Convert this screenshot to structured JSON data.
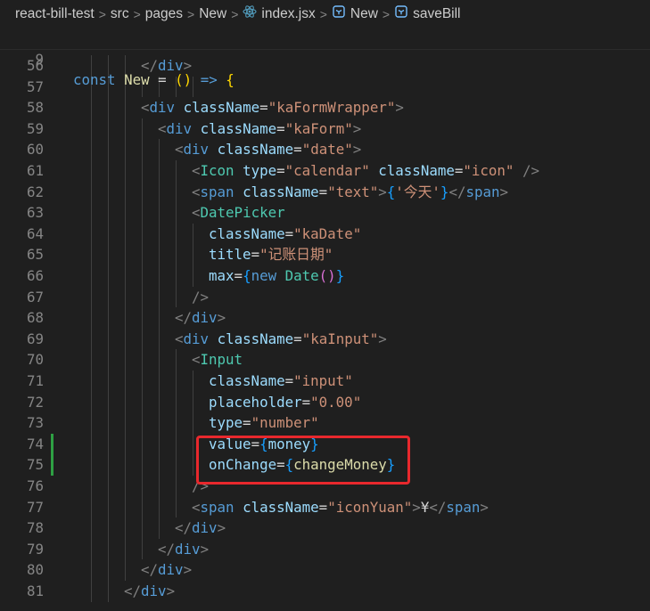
{
  "breadcrumb": {
    "items": [
      "react-bill-test",
      "src",
      "pages",
      "New",
      "index.jsx",
      "New",
      "saveBill"
    ],
    "separator": ">",
    "icons": [
      "",
      "",
      "",
      "",
      "react-icon",
      "symbol-cube-icon",
      "symbol-cube-icon"
    ]
  },
  "sticky_line": {
    "number": "9",
    "tokens": [
      {
        "t": "const ",
        "c": "kw"
      },
      {
        "t": "New",
        "c": "fn"
      },
      {
        "t": " = ",
        "c": "plain"
      },
      {
        "t": "()",
        "c": "yellowbrace"
      },
      {
        "t": " => ",
        "c": "kw"
      },
      {
        "t": "{",
        "c": "yellowbrace"
      }
    ]
  },
  "lines": [
    {
      "number": "56",
      "indent": 8,
      "tokens": [
        {
          "t": "</",
          "c": "punct"
        },
        {
          "t": "div",
          "c": "tag"
        },
        {
          "t": ">",
          "c": "punct"
        }
      ]
    },
    {
      "number": "57",
      "indent": 0,
      "tokens": []
    },
    {
      "number": "58",
      "indent": 8,
      "tokens": [
        {
          "t": "<",
          "c": "punct"
        },
        {
          "t": "div",
          "c": "tag"
        },
        {
          "t": " className",
          "c": "attr"
        },
        {
          "t": "=",
          "c": "plain"
        },
        {
          "t": "\"kaFormWrapper\"",
          "c": "str"
        },
        {
          "t": ">",
          "c": "punct"
        }
      ]
    },
    {
      "number": "59",
      "indent": 10,
      "tokens": [
        {
          "t": "<",
          "c": "punct"
        },
        {
          "t": "div",
          "c": "tag"
        },
        {
          "t": " className",
          "c": "attr"
        },
        {
          "t": "=",
          "c": "plain"
        },
        {
          "t": "\"kaForm\"",
          "c": "str"
        },
        {
          "t": ">",
          "c": "punct"
        }
      ]
    },
    {
      "number": "60",
      "indent": 12,
      "tokens": [
        {
          "t": "<",
          "c": "punct"
        },
        {
          "t": "div",
          "c": "tag"
        },
        {
          "t": " className",
          "c": "attr"
        },
        {
          "t": "=",
          "c": "plain"
        },
        {
          "t": "\"date\"",
          "c": "str"
        },
        {
          "t": ">",
          "c": "punct"
        }
      ]
    },
    {
      "number": "61",
      "indent": 14,
      "tokens": [
        {
          "t": "<",
          "c": "punct"
        },
        {
          "t": "Icon",
          "c": "comp"
        },
        {
          "t": " type",
          "c": "attr"
        },
        {
          "t": "=",
          "c": "plain"
        },
        {
          "t": "\"calendar\"",
          "c": "str"
        },
        {
          "t": " className",
          "c": "attr"
        },
        {
          "t": "=",
          "c": "plain"
        },
        {
          "t": "\"icon\"",
          "c": "str"
        },
        {
          "t": " />",
          "c": "punct"
        }
      ]
    },
    {
      "number": "62",
      "indent": 14,
      "tokens": [
        {
          "t": "<",
          "c": "punct"
        },
        {
          "t": "span",
          "c": "tag"
        },
        {
          "t": " className",
          "c": "attr"
        },
        {
          "t": "=",
          "c": "plain"
        },
        {
          "t": "\"text\"",
          "c": "str"
        },
        {
          "t": ">",
          "c": "punct"
        },
        {
          "t": "{",
          "c": "brace"
        },
        {
          "t": "'今天'",
          "c": "str"
        },
        {
          "t": "}",
          "c": "brace"
        },
        {
          "t": "</",
          "c": "punct"
        },
        {
          "t": "span",
          "c": "tag"
        },
        {
          "t": ">",
          "c": "punct"
        }
      ]
    },
    {
      "number": "63",
      "indent": 14,
      "tokens": [
        {
          "t": "<",
          "c": "punct"
        },
        {
          "t": "DatePicker",
          "c": "comp"
        }
      ]
    },
    {
      "number": "64",
      "indent": 16,
      "tokens": [
        {
          "t": "className",
          "c": "attr"
        },
        {
          "t": "=",
          "c": "plain"
        },
        {
          "t": "\"kaDate\"",
          "c": "str"
        }
      ]
    },
    {
      "number": "65",
      "indent": 16,
      "tokens": [
        {
          "t": "title",
          "c": "attr"
        },
        {
          "t": "=",
          "c": "plain"
        },
        {
          "t": "\"记账日期\"",
          "c": "str"
        }
      ]
    },
    {
      "number": "66",
      "indent": 16,
      "tokens": [
        {
          "t": "max",
          "c": "attr"
        },
        {
          "t": "=",
          "c": "plain"
        },
        {
          "t": "{",
          "c": "brace"
        },
        {
          "t": "new ",
          "c": "kw"
        },
        {
          "t": "Date",
          "c": "comp"
        },
        {
          "t": "()",
          "c": "brace2"
        },
        {
          "t": "}",
          "c": "brace"
        }
      ]
    },
    {
      "number": "67",
      "indent": 14,
      "tokens": [
        {
          "t": "/>",
          "c": "punct"
        }
      ]
    },
    {
      "number": "68",
      "indent": 12,
      "tokens": [
        {
          "t": "</",
          "c": "punct"
        },
        {
          "t": "div",
          "c": "tag"
        },
        {
          "t": ">",
          "c": "punct"
        }
      ]
    },
    {
      "number": "69",
      "indent": 12,
      "tokens": [
        {
          "t": "<",
          "c": "punct"
        },
        {
          "t": "div",
          "c": "tag"
        },
        {
          "t": " className",
          "c": "attr"
        },
        {
          "t": "=",
          "c": "plain"
        },
        {
          "t": "\"kaInput\"",
          "c": "str"
        },
        {
          "t": ">",
          "c": "punct"
        }
      ]
    },
    {
      "number": "70",
      "indent": 14,
      "tokens": [
        {
          "t": "<",
          "c": "punct"
        },
        {
          "t": "Input",
          "c": "comp"
        }
      ]
    },
    {
      "number": "71",
      "indent": 16,
      "tokens": [
        {
          "t": "className",
          "c": "attr"
        },
        {
          "t": "=",
          "c": "plain"
        },
        {
          "t": "\"input\"",
          "c": "str"
        }
      ]
    },
    {
      "number": "72",
      "indent": 16,
      "tokens": [
        {
          "t": "placeholder",
          "c": "attr"
        },
        {
          "t": "=",
          "c": "plain"
        },
        {
          "t": "\"0.00\"",
          "c": "str"
        }
      ]
    },
    {
      "number": "73",
      "indent": 16,
      "tokens": [
        {
          "t": "type",
          "c": "attr"
        },
        {
          "t": "=",
          "c": "plain"
        },
        {
          "t": "\"number\"",
          "c": "str"
        }
      ]
    },
    {
      "number": "74",
      "indent": 16,
      "modified": true,
      "tokens": [
        {
          "t": "value",
          "c": "attr"
        },
        {
          "t": "=",
          "c": "plain"
        },
        {
          "t": "{",
          "c": "brace"
        },
        {
          "t": "money",
          "c": "var"
        },
        {
          "t": "}",
          "c": "brace"
        }
      ]
    },
    {
      "number": "75",
      "indent": 16,
      "modified": true,
      "tokens": [
        {
          "t": "onChange",
          "c": "attr"
        },
        {
          "t": "=",
          "c": "plain"
        },
        {
          "t": "{",
          "c": "brace"
        },
        {
          "t": "changeMoney",
          "c": "fn"
        },
        {
          "t": "}",
          "c": "brace"
        }
      ]
    },
    {
      "number": "76",
      "indent": 14,
      "tokens": [
        {
          "t": "/>",
          "c": "punct"
        }
      ]
    },
    {
      "number": "77",
      "indent": 14,
      "tokens": [
        {
          "t": "<",
          "c": "punct"
        },
        {
          "t": "span",
          "c": "tag"
        },
        {
          "t": " className",
          "c": "attr"
        },
        {
          "t": "=",
          "c": "plain"
        },
        {
          "t": "\"iconYuan\"",
          "c": "str"
        },
        {
          "t": ">",
          "c": "punct"
        },
        {
          "t": "¥",
          "c": "plain"
        },
        {
          "t": "</",
          "c": "punct"
        },
        {
          "t": "span",
          "c": "tag"
        },
        {
          "t": ">",
          "c": "punct"
        }
      ]
    },
    {
      "number": "78",
      "indent": 12,
      "tokens": [
        {
          "t": "</",
          "c": "punct"
        },
        {
          "t": "div",
          "c": "tag"
        },
        {
          "t": ">",
          "c": "punct"
        }
      ]
    },
    {
      "number": "79",
      "indent": 10,
      "tokens": [
        {
          "t": "</",
          "c": "punct"
        },
        {
          "t": "div",
          "c": "tag"
        },
        {
          "t": ">",
          "c": "punct"
        }
      ]
    },
    {
      "number": "80",
      "indent": 8,
      "tokens": [
        {
          "t": "</",
          "c": "punct"
        },
        {
          "t": "div",
          "c": "tag"
        },
        {
          "t": ">",
          "c": "punct"
        }
      ]
    },
    {
      "number": "81",
      "indent": 6,
      "tokens": [
        {
          "t": "</",
          "c": "punct"
        },
        {
          "t": "div",
          "c": "tag"
        },
        {
          "t": ">",
          "c": "punct"
        }
      ]
    }
  ],
  "colors": {
    "background": "#1f1f1f",
    "line_number": "#858585",
    "highlight_box": "#e8282d",
    "modified_gutter": "#2ea043"
  }
}
